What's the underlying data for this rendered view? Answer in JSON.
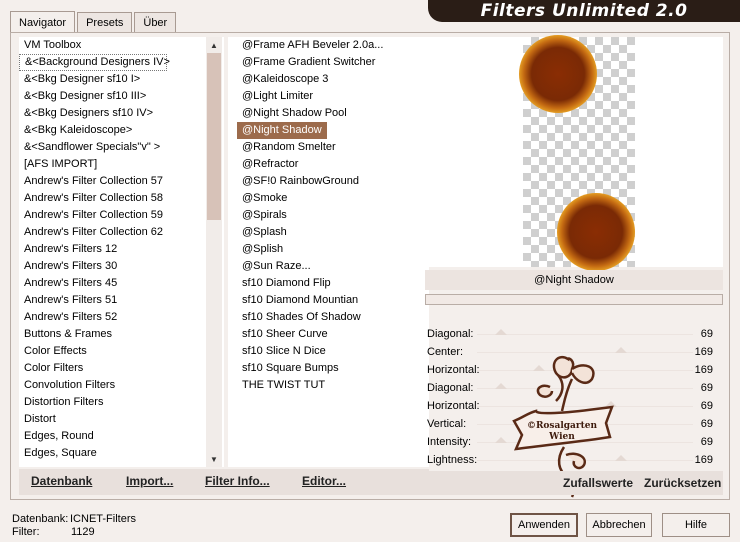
{
  "tabs": [
    "Navigator",
    "Presets",
    "Über"
  ],
  "app_title": "Filters Unlimited 2.0",
  "categories": [
    "VM Toolbox",
    "&<Background Designers IV>",
    "&<Bkg Designer sf10 I>",
    "&<Bkg Designer sf10 III>",
    "&<Bkg Designers sf10 IV>",
    "&<Bkg Kaleidoscope>",
    "&<Sandflower Specials\"v\" >",
    "[AFS IMPORT]",
    "Andrew's Filter Collection 57",
    "Andrew's Filter Collection 58",
    "Andrew's Filter Collection 59",
    "Andrew's Filter Collection 62",
    "Andrew's Filters 12",
    "Andrew's Filters 30",
    "Andrew's Filters 45",
    "Andrew's Filters 51",
    "Andrew's Filters 52",
    "Buttons & Frames",
    "Color Effects",
    "Color Filters",
    "Convolution Filters",
    "Distortion Filters",
    "Distort",
    "Edges, Round",
    "Edges, Square"
  ],
  "selected_category_index": 1,
  "filters": [
    "@Frame AFH Beveler 2.0a...",
    "@Frame Gradient Switcher",
    "@Kaleidoscope 3",
    "@Light Limiter",
    "@Night Shadow Pool",
    "@Night Shadow",
    "@Random Smelter",
    "@Refractor",
    "@SF!0 RainbowGround",
    "@Smoke",
    "@Spirals",
    "@Splash",
    "@Splish",
    "@Sun Raze...",
    "sf10 Diamond Flip",
    "sf10 Diamond Mountian",
    "sf10 Shades Of Shadow",
    "sf10 Sheer Curve",
    "sf10 Slice N Dice",
    "sf10 Square Bumps",
    "THE TWIST TUT"
  ],
  "selected_filter_index": 5,
  "bottom_buttons": {
    "datenbank": "Datenbank",
    "import": "Import...",
    "filter_info": "Filter Info...",
    "editor": "Editor..."
  },
  "current_filter": "@Night Shadow",
  "params": [
    {
      "label": "Diagonal:",
      "value": "69"
    },
    {
      "label": "Center:",
      "value": "169"
    },
    {
      "label": "Horizontal:",
      "value": "169"
    },
    {
      "label": "Diagonal:",
      "value": "69"
    },
    {
      "label": "Horizontal:",
      "value": "69"
    },
    {
      "label": "Vertical:",
      "value": "69"
    },
    {
      "label": "Intensity:",
      "value": "69"
    },
    {
      "label": "Lightness:",
      "value": "169"
    }
  ],
  "random_label": "Zufallswerte",
  "reset_label": "Zurücksetzen",
  "footer": {
    "db_label": "Datenbank:",
    "db_value": "ICNET-Filters",
    "filter_label": "Filter:",
    "filter_value": "1129"
  },
  "dialog_buttons": {
    "apply": "Anwenden",
    "cancel": "Abbrechen",
    "help": "Hilfe"
  },
  "watermark_text": "©Rosalgarten Wien"
}
